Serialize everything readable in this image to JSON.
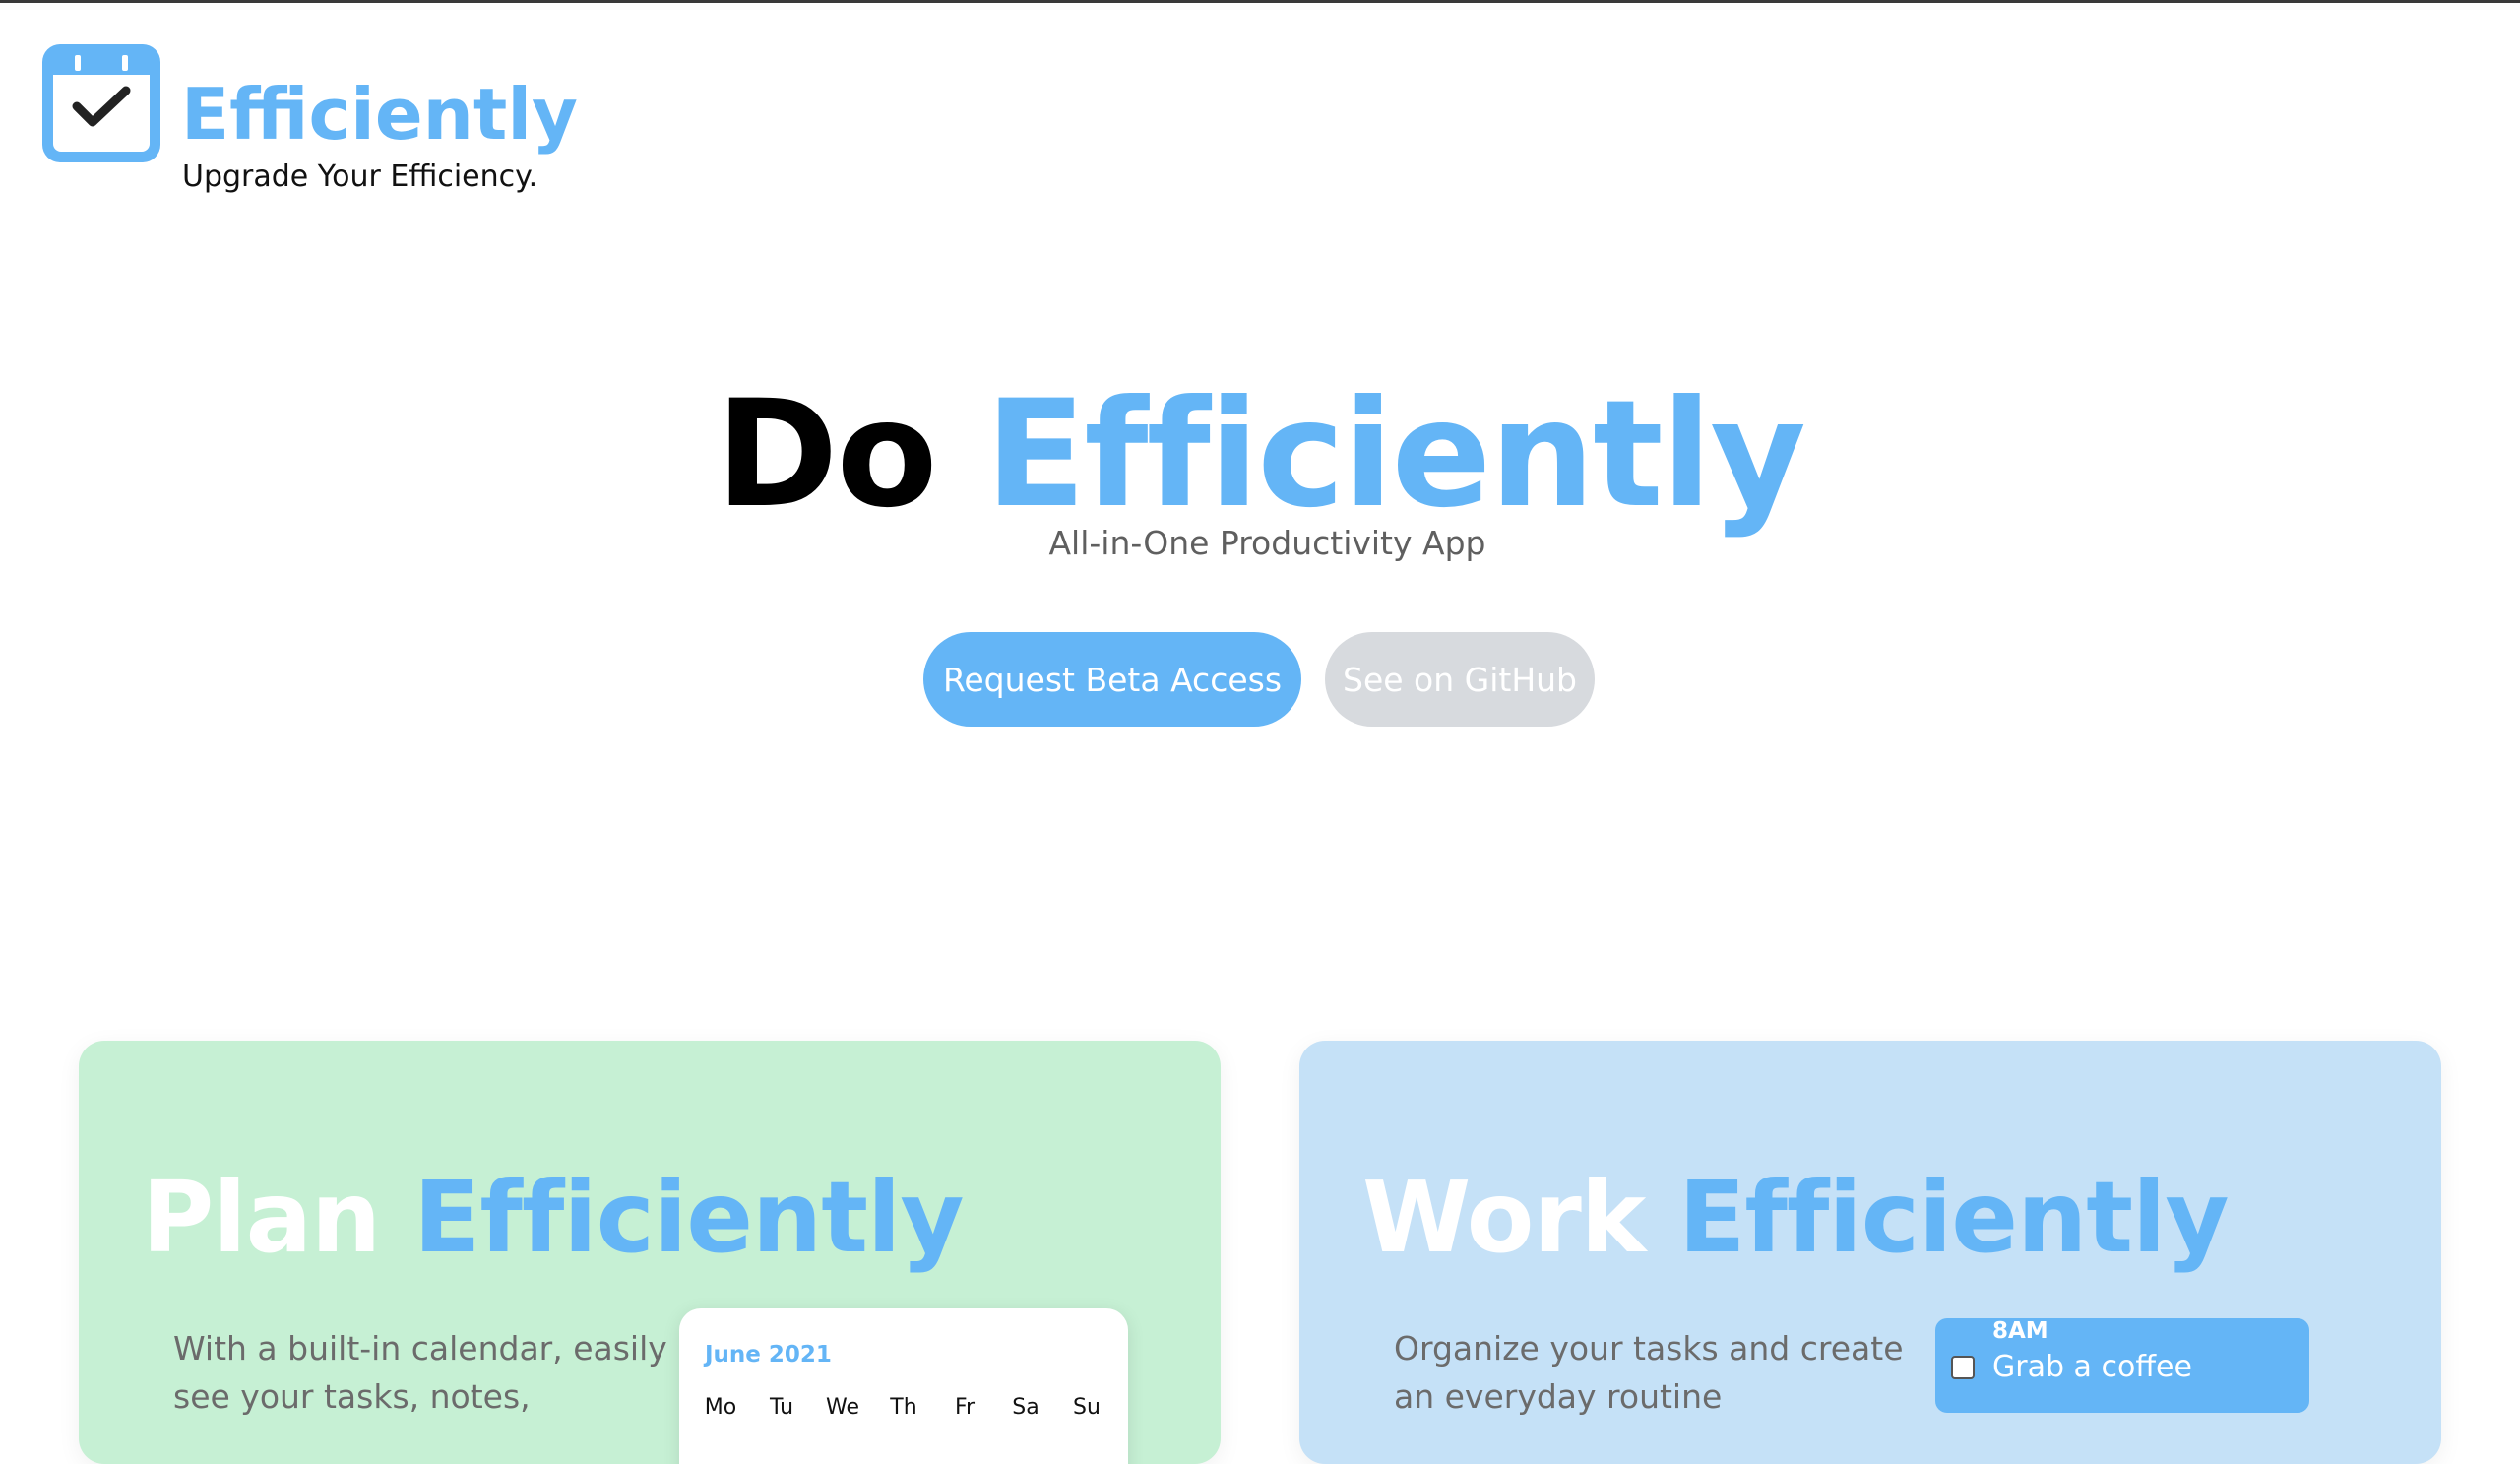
{
  "colors": {
    "accent": "#64b5f6",
    "plan_card_bg": "#c6f0d4",
    "work_card_bg": "#c5e1f7",
    "secondary_button_bg": "#d7dade"
  },
  "brand": {
    "logo_icon": "calendar-check-icon",
    "name": "Efficiently",
    "tagline": "Upgrade Your Efficiency."
  },
  "hero": {
    "title_part1": "Do",
    "title_part2": "Efficiently",
    "subtitle": "All-in-One Productivity App",
    "primary_button": "Request Beta Access",
    "secondary_button": "See on GitHub"
  },
  "features": {
    "plan": {
      "title_part1": "Plan",
      "title_part2": "Efficiently",
      "description": "With a built-in calendar, easily see your tasks, notes,",
      "calendar": {
        "month": "June 2021",
        "days": [
          "Mo",
          "Tu",
          "We",
          "Th",
          "Fr",
          "Sa",
          "Su"
        ]
      }
    },
    "work": {
      "title_part1": "Work",
      "title_part2": "Efficiently",
      "description": "Organize your tasks and create an everyday routine",
      "task": {
        "time": "8AM",
        "label": "Grab a coffee"
      }
    }
  }
}
